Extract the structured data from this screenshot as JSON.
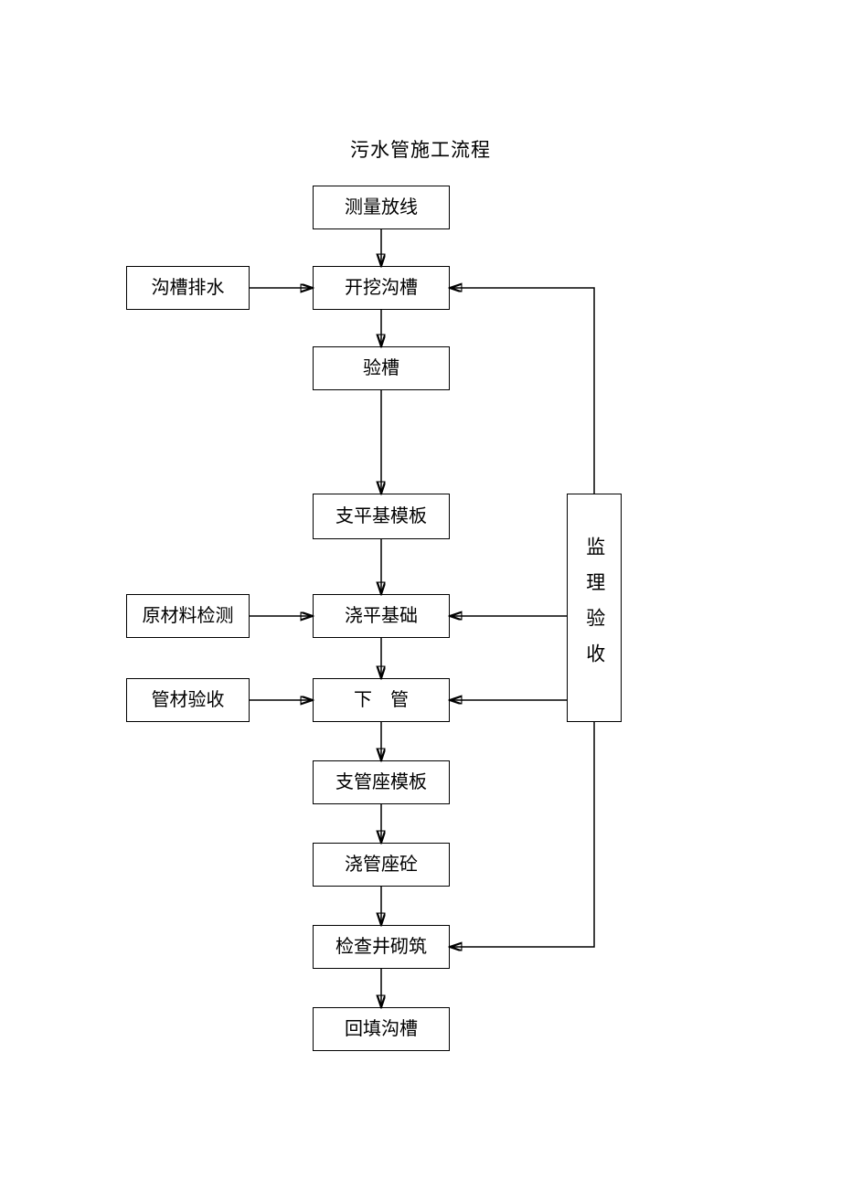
{
  "title": "污水管施工流程",
  "nodes": {
    "n1": "测量放线",
    "n2": "开挖沟槽",
    "n3": "验槽",
    "n4": "支平基模板",
    "n5": "浇平基础",
    "n6": "下　管",
    "n7": "支管座模板",
    "n8": "浇管座砼",
    "n9": "检查井砌筑",
    "n10": "回填沟槽",
    "s1": "沟槽排水",
    "s2": "原材料检测",
    "s3": "管材验收",
    "r1": "监理验收"
  }
}
